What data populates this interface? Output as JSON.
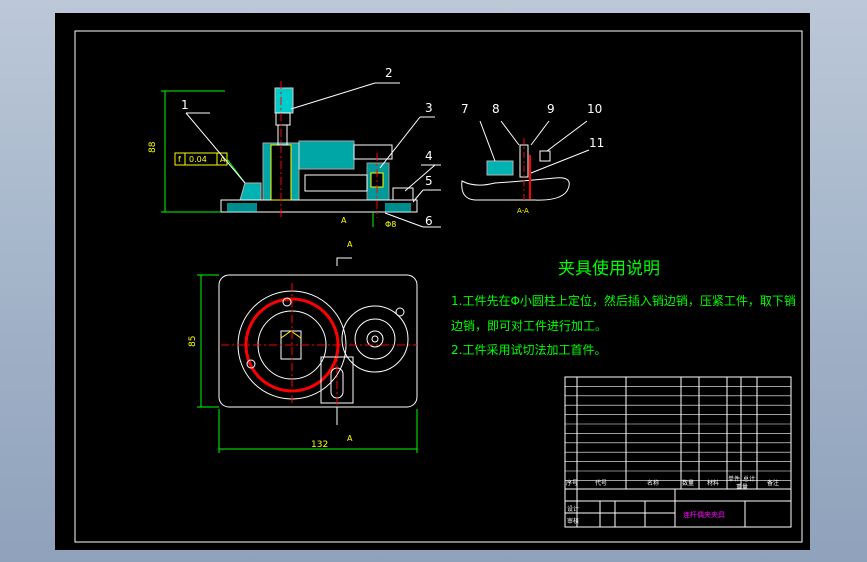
{
  "drawing": {
    "balloons": [
      "1",
      "2",
      "3",
      "4",
      "5",
      "6",
      "7",
      "8",
      "9",
      "10",
      "11"
    ],
    "tolerance_frame": [
      "f",
      "0.04",
      "A"
    ],
    "dims": {
      "height_front": "88",
      "width_plan": "132",
      "height_plan": "85",
      "small_front": "Φ8"
    },
    "section_mark": "A",
    "section_label": "A-A"
  },
  "notes": {
    "title": "夹具使用说明",
    "lines": [
      "1.工件先在Φ小圆柱上定位，然后插入销边销，压紧工件，取下销",
      "边销，即可对工件进行加工。",
      "2.工件采用试切法加工首件。"
    ]
  },
  "title_block": {
    "header_labels": [
      "序号",
      "代号",
      "名称",
      "数量",
      "材料",
      "单件",
      "总计",
      "备注"
    ],
    "weight_label": "重量",
    "drawing_name": "连杆偶夹夹具",
    "left_labels": [
      "设计",
      "审核"
    ]
  },
  "colors": {
    "background": "#000000",
    "frame": "#ffffff",
    "yellow": "#ffff00",
    "green": "#00ff00",
    "red": "#ff0000",
    "cyan": "#00ffff",
    "magenta": "#ff00ff"
  }
}
